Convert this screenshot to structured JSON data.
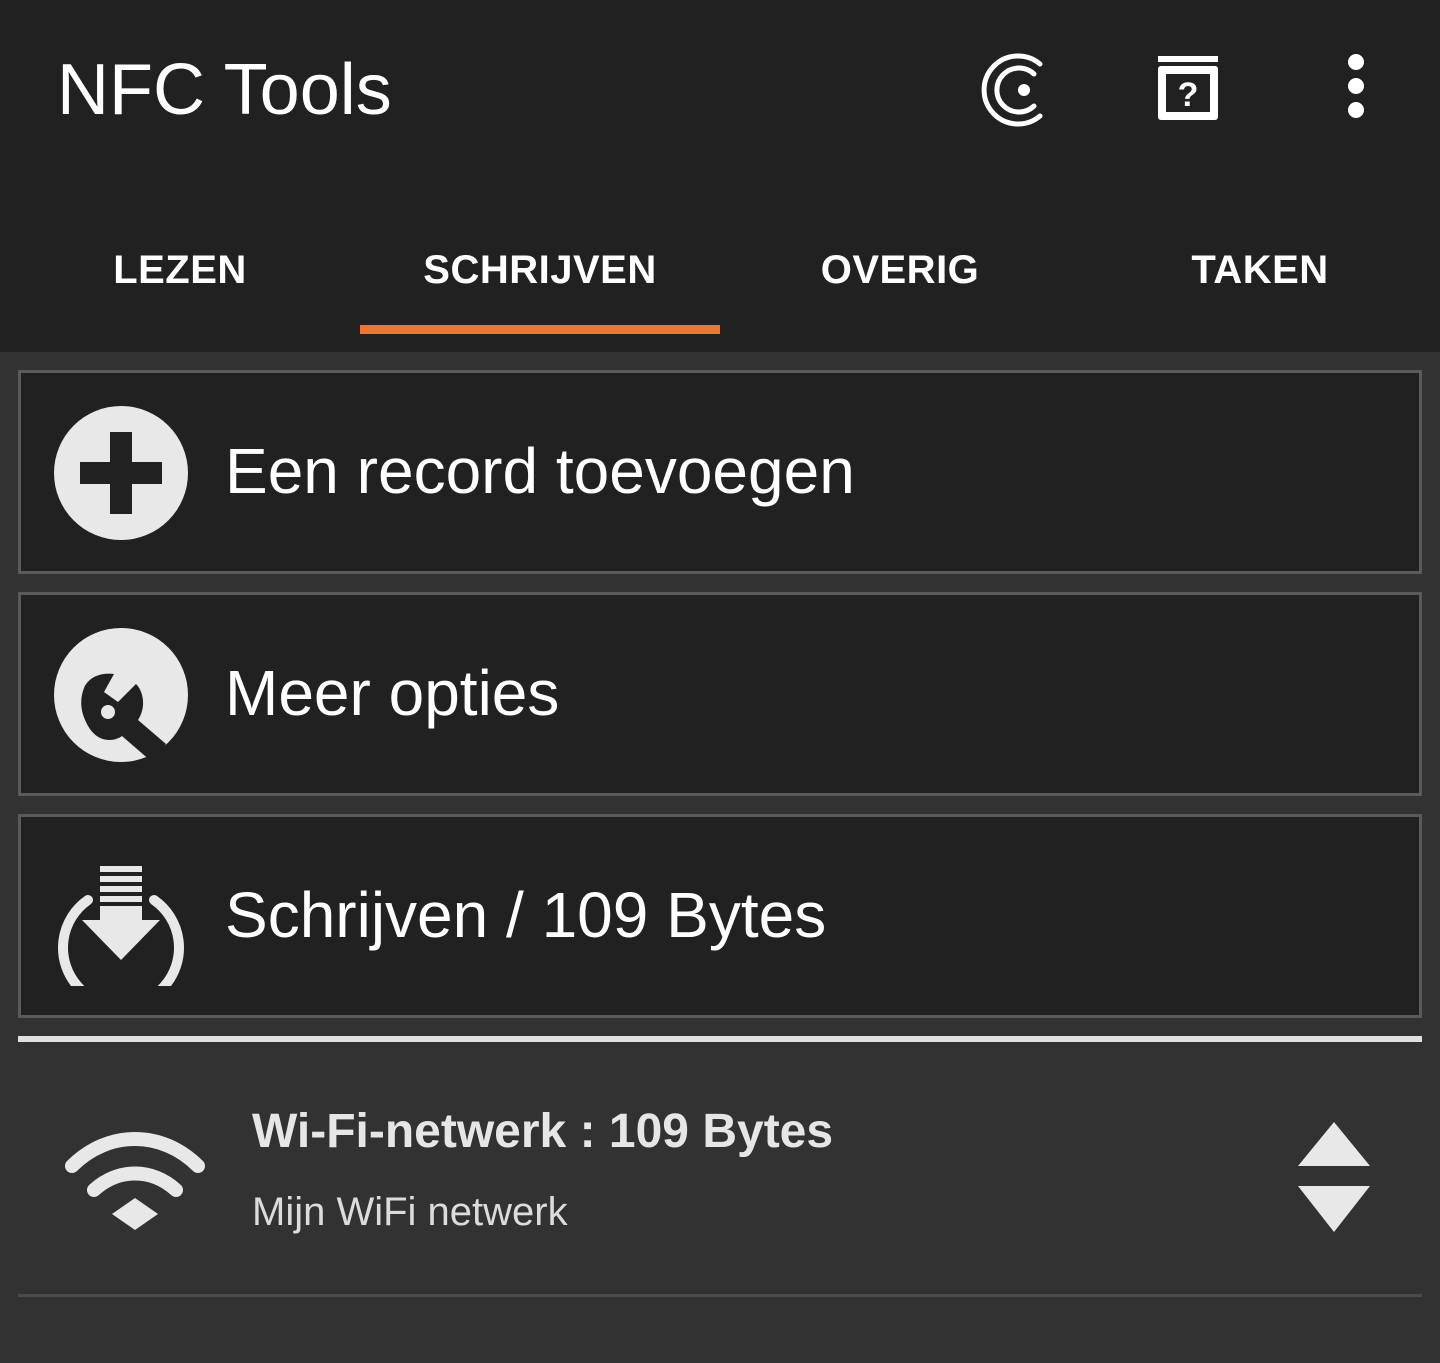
{
  "appbar": {
    "title": "NFC Tools",
    "actions": [
      "coin-icon",
      "help-book-icon",
      "more-vert-icon"
    ]
  },
  "tabs": [
    {
      "label": "LEZEN",
      "active": false
    },
    {
      "label": "SCHRIJVEN",
      "active": true
    },
    {
      "label": "OVERIG",
      "active": false
    },
    {
      "label": "TAKEN",
      "active": false
    }
  ],
  "cards": [
    {
      "label": "Een record toevoegen",
      "icon": "add-circle-icon"
    },
    {
      "label": "Meer opties",
      "icon": "wrench-icon"
    },
    {
      "label": "Schrijven / 109 Bytes",
      "icon": "write-download-icon"
    }
  ],
  "record": {
    "title": "Wi-Fi-netwerk : 109 Bytes",
    "subtitle": "Mijn WiFi netwerk",
    "icon": "wifi-icon"
  },
  "colors": {
    "appbar_bg": "#212121",
    "content_bg": "#323232",
    "accent": "#f07434",
    "card_border": "#5a5a5a",
    "icon_fill": "#e8e8e8"
  }
}
